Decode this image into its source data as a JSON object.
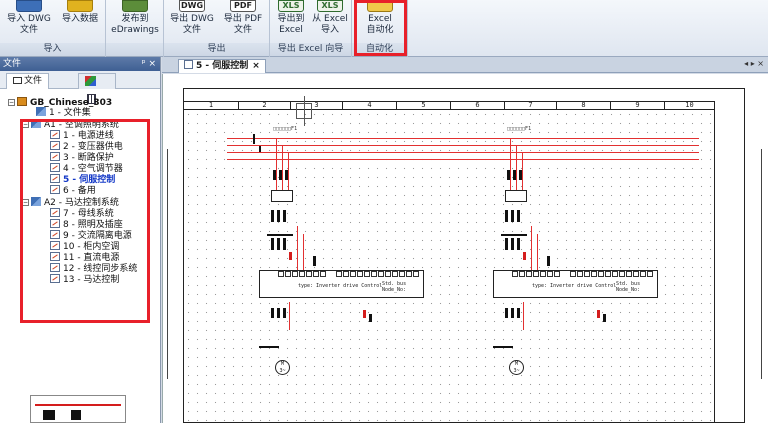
{
  "ribbon": {
    "groups": [
      {
        "label": "导入",
        "buttons": [
          "导入 DWG\n文件",
          "导入数据"
        ]
      },
      {
        "label": "",
        "buttons": [
          "发布到\neDrawings"
        ]
      },
      {
        "label": "导出",
        "buttons": [
          "导出 DWG\n文件",
          "导出 PDF\n文件"
        ]
      },
      {
        "label": "导出 Excel 向导",
        "buttons": [
          "导出到\nExcel",
          "从 Excel\n导入"
        ]
      },
      {
        "label": "自动化",
        "buttons": [
          "Excel\n自动化"
        ]
      }
    ],
    "icon_labels": {
      "dwg": "DWG",
      "pdf": "PDF",
      "xls": "XLS"
    }
  },
  "panel": {
    "title": "文件",
    "pin": "ᵖ ×",
    "tabs": [
      "文件"
    ],
    "tree": {
      "root": "GB_Chinese_303",
      "root_children": [
        "1 - 文件集"
      ],
      "group1": {
        "label": "A1 - 空调照明系统",
        "items": [
          "1 - 电源进线",
          "2 - 变压器供电",
          "3 - 断路保护",
          "4 - 空气调节器",
          "5 - 伺服控制",
          "6 - 备用"
        ]
      },
      "group2": {
        "label": "A2 - 马达控制系统",
        "items": [
          "7 - 母线系统",
          "8 - 照明及插座",
          "9 - 交流隔离电源",
          "10 - 柜内空调",
          "11 - 直流电源",
          "12 - 线控同步系统",
          "13 - 马达控制"
        ]
      },
      "active_item": "5 - 伺服控制"
    }
  },
  "document": {
    "tab_label": "5 - 伺服控制",
    "tab_close": "×",
    "nav": "◂ ▸ ×",
    "ruler": [
      "1",
      "2",
      "3",
      "4",
      "5",
      "6",
      "7",
      "8",
      "9",
      "10"
    ],
    "device_text": "type: Inverter drive Control",
    "bus_text": "Std. bus",
    "bus_text2": "Node_No:",
    "motor_text": "M\n3~"
  },
  "colors": {
    "highlight": "#e8202a",
    "power_line": "#e23030",
    "active_tree_item": "#1338c7"
  }
}
